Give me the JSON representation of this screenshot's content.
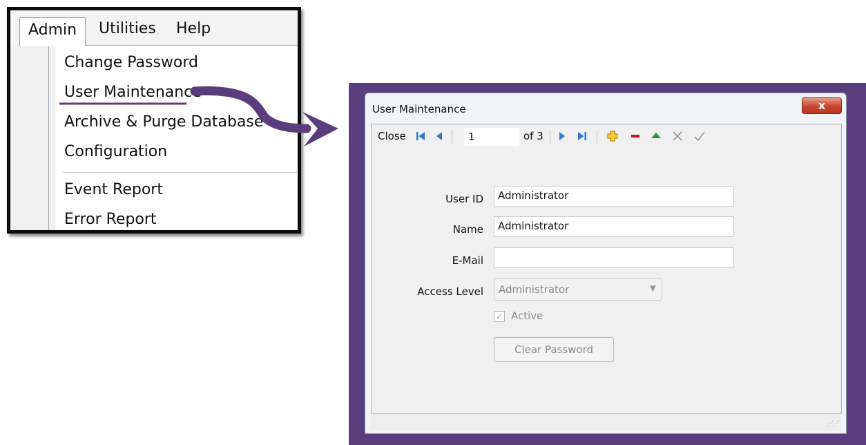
{
  "menubar": {
    "items": [
      "Admin",
      "Utilities",
      "Help"
    ]
  },
  "dropdown": {
    "items": [
      "Change Password",
      "User Maintenance",
      "Archive & Purge Database",
      "Configuration",
      "Event Report",
      "Error Report"
    ]
  },
  "dialog": {
    "title": "User Maintenance",
    "close_glyph": "x",
    "toolbar": {
      "close_label": "Close",
      "record_position": "1",
      "record_of": "of 3"
    },
    "fields": {
      "user_id_label": "User ID",
      "user_id_value": "Administrator",
      "name_label": "Name",
      "name_value": "Administrator",
      "email_label": "E-Mail",
      "email_value": "",
      "access_level_label": "Access Level",
      "access_level_value": "Administrator",
      "active_label": "Active",
      "active_checked": true,
      "clear_password_label": "Clear Password"
    }
  },
  "colors": {
    "accent_purple": "#5a3d7c",
    "nav_blue": "#2a7ad6",
    "add_orange": "#e8a400",
    "delete_red": "#cc1111",
    "up_green": "#1aa32a"
  },
  "icons": [
    "first-record-icon",
    "prev-record-icon",
    "next-record-icon",
    "last-record-icon",
    "add-record-icon",
    "delete-record-icon",
    "move-up-icon",
    "cancel-icon",
    "confirm-icon"
  ]
}
